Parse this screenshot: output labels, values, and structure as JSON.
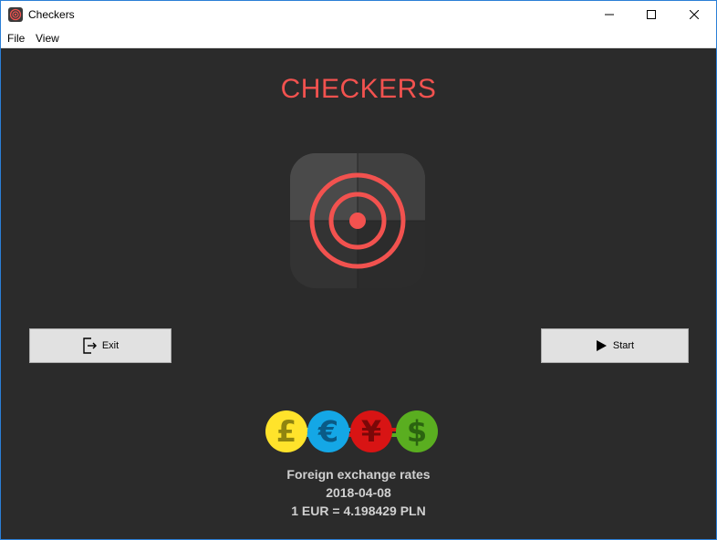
{
  "window": {
    "title": "Checkers",
    "controls": {
      "minimize": "minimize-icon",
      "maximize": "maximize-icon",
      "close": "close-icon"
    }
  },
  "menu": {
    "items": [
      {
        "label": "File"
      },
      {
        "label": "View"
      }
    ]
  },
  "main": {
    "title": "CHECKERS",
    "accent_color": "#f2524f",
    "background_color": "#2b2b2b",
    "logo_icon": "target-icon",
    "exit_button": {
      "label": "Exit",
      "icon": "exit-icon"
    },
    "start_button": {
      "label": "Start",
      "icon": "play-icon"
    }
  },
  "forex": {
    "icons": [
      "pound-coin-icon",
      "euro-coin-icon",
      "yen-coin-icon",
      "dollar-coin-icon"
    ],
    "symbols": [
      "£",
      "€",
      "¥",
      "$"
    ],
    "heading": "Foreign exchange rates",
    "date": "2018-04-08",
    "rate": "1 EUR = 4.198429 PLN"
  }
}
